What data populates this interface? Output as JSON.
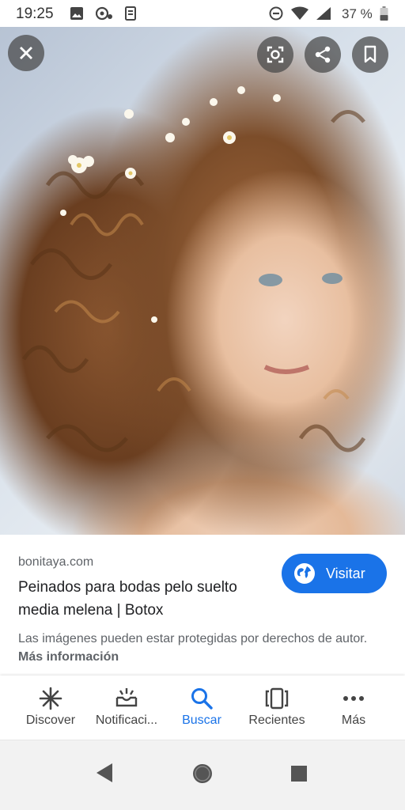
{
  "status_bar": {
    "time": "19:25",
    "battery_text": "37 %",
    "icons": [
      "image-icon",
      "assistant-icon",
      "vibrate-icon",
      "do-not-disturb-icon",
      "wifi-icon",
      "signal-icon",
      "battery-icon"
    ]
  },
  "image_viewer": {
    "image_subject": "Woman with long curly hair adorned with small white flowers",
    "buttons": [
      "close-icon",
      "lens-icon",
      "share-icon",
      "bookmark-icon"
    ]
  },
  "result": {
    "source": "bonitaya.com",
    "title": "Peinados para bodas pelo suelto media melena | Botox",
    "visit_label": "Visitar",
    "notice_text": "Las imágenes pueden estar protegidas por derechos de autor.",
    "more_info_label": "Más información"
  },
  "bottom_nav": {
    "items": [
      {
        "label": "Discover",
        "icon": "discover-icon"
      },
      {
        "label": "Notificaci...",
        "icon": "notifications-icon"
      },
      {
        "label": "Buscar",
        "icon": "search-icon"
      },
      {
        "label": "Recientes",
        "icon": "recents-icon"
      },
      {
        "label": "Más",
        "icon": "more-icon"
      }
    ],
    "active_index": 2
  },
  "colors": {
    "accent": "#1a73e8",
    "text_primary": "#202124",
    "text_secondary": "#5f6368"
  }
}
